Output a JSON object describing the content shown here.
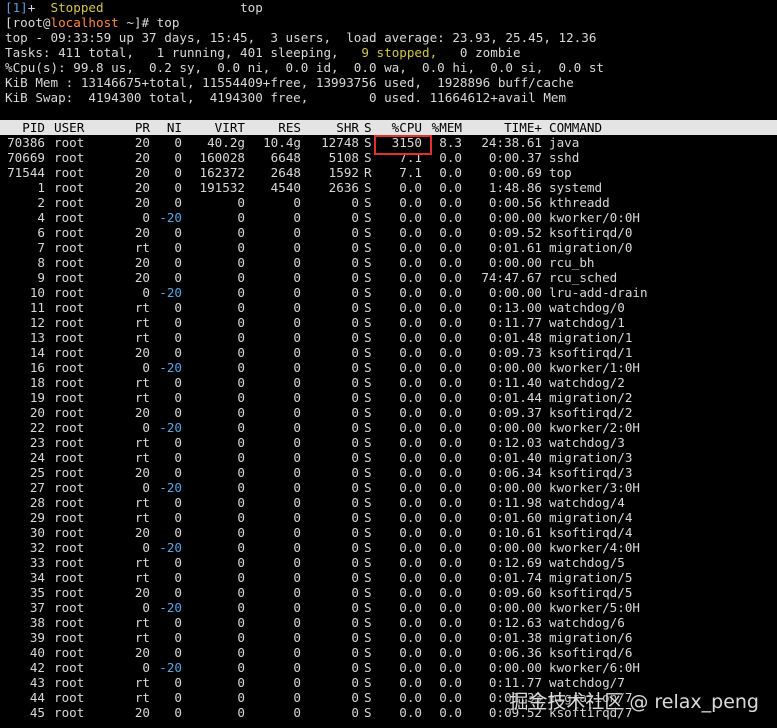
{
  "job_line": {
    "id": "[1]",
    "plus": "+",
    "status": "Stopped",
    "command": "top"
  },
  "prompt_line": {
    "open": "[root@",
    "host": "localhost",
    "rest": " ~]# top"
  },
  "summary": [
    "top - 09:33:59 up 37 days, 15:45,  3 users,  load average: 23.93, 25.45, 12.36",
    "Tasks: 411 total,   1 running, 401 sleeping,   ",
    "%Cpu(s): 99.8 us,  0.2 sy,  0.0 ni,  0.0 id,  0.0 wa,  0.0 hi,  0.0 si,  0.0 st",
    "KiB Mem : 13146675+total, 11554409+free, 13993756 used,  1928896 buff/cache",
    "KiB Swap:  4194300 total,  4194300 free,        0 used. 11664612+avail Mem"
  ],
  "tasks_stopped": "9 stopped,",
  "tasks_zombie": "   0 zombie",
  "columns": {
    "pid": "PID",
    "user": "USER",
    "pr": "PR",
    "ni": "NI",
    "virt": "VIRT",
    "res": "RES",
    "shr": "SHR",
    "s": "S",
    "cpu": "%CPU",
    "mem": "%MEM",
    "time": "TIME+",
    "command": "COMMAND"
  },
  "processes": [
    {
      "pid": "70386",
      "user": "root",
      "pr": "20",
      "ni": "0",
      "virt": "40.2g",
      "res": "10.4g",
      "shr": "12748",
      "s": "S",
      "cpu": "3150",
      "mem": "8.3",
      "time": "24:38.61",
      "command": "java"
    },
    {
      "pid": "70669",
      "user": "root",
      "pr": "20",
      "ni": "0",
      "virt": "160028",
      "res": "6648",
      "shr": "5108",
      "s": "S",
      "cpu": "7.1",
      "mem": "0.0",
      "time": "0:00.37",
      "command": "sshd"
    },
    {
      "pid": "71544",
      "user": "root",
      "pr": "20",
      "ni": "0",
      "virt": "162372",
      "res": "2648",
      "shr": "1592",
      "s": "R",
      "cpu": "7.1",
      "mem": "0.0",
      "time": "0:00.69",
      "command": "top"
    },
    {
      "pid": "1",
      "user": "root",
      "pr": "20",
      "ni": "0",
      "virt": "191532",
      "res": "4540",
      "shr": "2636",
      "s": "S",
      "cpu": "0.0",
      "mem": "0.0",
      "time": "1:48.86",
      "command": "systemd"
    },
    {
      "pid": "2",
      "user": "root",
      "pr": "20",
      "ni": "0",
      "virt": "0",
      "res": "0",
      "shr": "0",
      "s": "S",
      "cpu": "0.0",
      "mem": "0.0",
      "time": "0:00.56",
      "command": "kthreadd"
    },
    {
      "pid": "4",
      "user": "root",
      "pr": "0",
      "ni": "-20",
      "virt": "0",
      "res": "0",
      "shr": "0",
      "s": "S",
      "cpu": "0.0",
      "mem": "0.0",
      "time": "0:00.00",
      "command": "kworker/0:0H"
    },
    {
      "pid": "6",
      "user": "root",
      "pr": "20",
      "ni": "0",
      "virt": "0",
      "res": "0",
      "shr": "0",
      "s": "S",
      "cpu": "0.0",
      "mem": "0.0",
      "time": "0:09.52",
      "command": "ksoftirqd/0"
    },
    {
      "pid": "7",
      "user": "root",
      "pr": "rt",
      "ni": "0",
      "virt": "0",
      "res": "0",
      "shr": "0",
      "s": "S",
      "cpu": "0.0",
      "mem": "0.0",
      "time": "0:01.61",
      "command": "migration/0"
    },
    {
      "pid": "8",
      "user": "root",
      "pr": "20",
      "ni": "0",
      "virt": "0",
      "res": "0",
      "shr": "0",
      "s": "S",
      "cpu": "0.0",
      "mem": "0.0",
      "time": "0:00.00",
      "command": "rcu_bh"
    },
    {
      "pid": "9",
      "user": "root",
      "pr": "20",
      "ni": "0",
      "virt": "0",
      "res": "0",
      "shr": "0",
      "s": "S",
      "cpu": "0.0",
      "mem": "0.0",
      "time": "74:47.67",
      "command": "rcu_sched"
    },
    {
      "pid": "10",
      "user": "root",
      "pr": "0",
      "ni": "-20",
      "virt": "0",
      "res": "0",
      "shr": "0",
      "s": "S",
      "cpu": "0.0",
      "mem": "0.0",
      "time": "0:00.00",
      "command": "lru-add-drain"
    },
    {
      "pid": "11",
      "user": "root",
      "pr": "rt",
      "ni": "0",
      "virt": "0",
      "res": "0",
      "shr": "0",
      "s": "S",
      "cpu": "0.0",
      "mem": "0.0",
      "time": "0:13.00",
      "command": "watchdog/0"
    },
    {
      "pid": "12",
      "user": "root",
      "pr": "rt",
      "ni": "0",
      "virt": "0",
      "res": "0",
      "shr": "0",
      "s": "S",
      "cpu": "0.0",
      "mem": "0.0",
      "time": "0:11.77",
      "command": "watchdog/1"
    },
    {
      "pid": "13",
      "user": "root",
      "pr": "rt",
      "ni": "0",
      "virt": "0",
      "res": "0",
      "shr": "0",
      "s": "S",
      "cpu": "0.0",
      "mem": "0.0",
      "time": "0:01.48",
      "command": "migration/1"
    },
    {
      "pid": "14",
      "user": "root",
      "pr": "20",
      "ni": "0",
      "virt": "0",
      "res": "0",
      "shr": "0",
      "s": "S",
      "cpu": "0.0",
      "mem": "0.0",
      "time": "0:09.73",
      "command": "ksoftirqd/1"
    },
    {
      "pid": "16",
      "user": "root",
      "pr": "0",
      "ni": "-20",
      "virt": "0",
      "res": "0",
      "shr": "0",
      "s": "S",
      "cpu": "0.0",
      "mem": "0.0",
      "time": "0:00.00",
      "command": "kworker/1:0H"
    },
    {
      "pid": "18",
      "user": "root",
      "pr": "rt",
      "ni": "0",
      "virt": "0",
      "res": "0",
      "shr": "0",
      "s": "S",
      "cpu": "0.0",
      "mem": "0.0",
      "time": "0:11.40",
      "command": "watchdog/2"
    },
    {
      "pid": "19",
      "user": "root",
      "pr": "rt",
      "ni": "0",
      "virt": "0",
      "res": "0",
      "shr": "0",
      "s": "S",
      "cpu": "0.0",
      "mem": "0.0",
      "time": "0:01.44",
      "command": "migration/2"
    },
    {
      "pid": "20",
      "user": "root",
      "pr": "20",
      "ni": "0",
      "virt": "0",
      "res": "0",
      "shr": "0",
      "s": "S",
      "cpu": "0.0",
      "mem": "0.0",
      "time": "0:09.37",
      "command": "ksoftirqd/2"
    },
    {
      "pid": "22",
      "user": "root",
      "pr": "0",
      "ni": "-20",
      "virt": "0",
      "res": "0",
      "shr": "0",
      "s": "S",
      "cpu": "0.0",
      "mem": "0.0",
      "time": "0:00.00",
      "command": "kworker/2:0H"
    },
    {
      "pid": "23",
      "user": "root",
      "pr": "rt",
      "ni": "0",
      "virt": "0",
      "res": "0",
      "shr": "0",
      "s": "S",
      "cpu": "0.0",
      "mem": "0.0",
      "time": "0:12.03",
      "command": "watchdog/3"
    },
    {
      "pid": "24",
      "user": "root",
      "pr": "rt",
      "ni": "0",
      "virt": "0",
      "res": "0",
      "shr": "0",
      "s": "S",
      "cpu": "0.0",
      "mem": "0.0",
      "time": "0:01.40",
      "command": "migration/3"
    },
    {
      "pid": "25",
      "user": "root",
      "pr": "20",
      "ni": "0",
      "virt": "0",
      "res": "0",
      "shr": "0",
      "s": "S",
      "cpu": "0.0",
      "mem": "0.0",
      "time": "0:06.34",
      "command": "ksoftirqd/3"
    },
    {
      "pid": "27",
      "user": "root",
      "pr": "0",
      "ni": "-20",
      "virt": "0",
      "res": "0",
      "shr": "0",
      "s": "S",
      "cpu": "0.0",
      "mem": "0.0",
      "time": "0:00.00",
      "command": "kworker/3:0H"
    },
    {
      "pid": "28",
      "user": "root",
      "pr": "rt",
      "ni": "0",
      "virt": "0",
      "res": "0",
      "shr": "0",
      "s": "S",
      "cpu": "0.0",
      "mem": "0.0",
      "time": "0:11.98",
      "command": "watchdog/4"
    },
    {
      "pid": "29",
      "user": "root",
      "pr": "rt",
      "ni": "0",
      "virt": "0",
      "res": "0",
      "shr": "0",
      "s": "S",
      "cpu": "0.0",
      "mem": "0.0",
      "time": "0:01.60",
      "command": "migration/4"
    },
    {
      "pid": "30",
      "user": "root",
      "pr": "20",
      "ni": "0",
      "virt": "0",
      "res": "0",
      "shr": "0",
      "s": "S",
      "cpu": "0.0",
      "mem": "0.0",
      "time": "0:10.61",
      "command": "ksoftirqd/4"
    },
    {
      "pid": "32",
      "user": "root",
      "pr": "0",
      "ni": "-20",
      "virt": "0",
      "res": "0",
      "shr": "0",
      "s": "S",
      "cpu": "0.0",
      "mem": "0.0",
      "time": "0:00.00",
      "command": "kworker/4:0H"
    },
    {
      "pid": "33",
      "user": "root",
      "pr": "rt",
      "ni": "0",
      "virt": "0",
      "res": "0",
      "shr": "0",
      "s": "S",
      "cpu": "0.0",
      "mem": "0.0",
      "time": "0:12.69",
      "command": "watchdog/5"
    },
    {
      "pid": "34",
      "user": "root",
      "pr": "rt",
      "ni": "0",
      "virt": "0",
      "res": "0",
      "shr": "0",
      "s": "S",
      "cpu": "0.0",
      "mem": "0.0",
      "time": "0:01.74",
      "command": "migration/5"
    },
    {
      "pid": "35",
      "user": "root",
      "pr": "20",
      "ni": "0",
      "virt": "0",
      "res": "0",
      "shr": "0",
      "s": "S",
      "cpu": "0.0",
      "mem": "0.0",
      "time": "0:09.60",
      "command": "ksoftirqd/5"
    },
    {
      "pid": "37",
      "user": "root",
      "pr": "0",
      "ni": "-20",
      "virt": "0",
      "res": "0",
      "shr": "0",
      "s": "S",
      "cpu": "0.0",
      "mem": "0.0",
      "time": "0:00.00",
      "command": "kworker/5:0H"
    },
    {
      "pid": "38",
      "user": "root",
      "pr": "rt",
      "ni": "0",
      "virt": "0",
      "res": "0",
      "shr": "0",
      "s": "S",
      "cpu": "0.0",
      "mem": "0.0",
      "time": "0:12.63",
      "command": "watchdog/6"
    },
    {
      "pid": "39",
      "user": "root",
      "pr": "rt",
      "ni": "0",
      "virt": "0",
      "res": "0",
      "shr": "0",
      "s": "S",
      "cpu": "0.0",
      "mem": "0.0",
      "time": "0:01.38",
      "command": "migration/6"
    },
    {
      "pid": "40",
      "user": "root",
      "pr": "20",
      "ni": "0",
      "virt": "0",
      "res": "0",
      "shr": "0",
      "s": "S",
      "cpu": "0.0",
      "mem": "0.0",
      "time": "0:06.36",
      "command": "ksoftirqd/6"
    },
    {
      "pid": "42",
      "user": "root",
      "pr": "0",
      "ni": "-20",
      "virt": "0",
      "res": "0",
      "shr": "0",
      "s": "S",
      "cpu": "0.0",
      "mem": "0.0",
      "time": "0:00.00",
      "command": "kworker/6:0H"
    },
    {
      "pid": "43",
      "user": "root",
      "pr": "rt",
      "ni": "0",
      "virt": "0",
      "res": "0",
      "shr": "0",
      "s": "S",
      "cpu": "0.0",
      "mem": "0.0",
      "time": "0:11.77",
      "command": "watchdog/7"
    },
    {
      "pid": "44",
      "user": "root",
      "pr": "rt",
      "ni": "0",
      "virt": "0",
      "res": "0",
      "shr": "0",
      "s": "S",
      "cpu": "0.0",
      "mem": "0.0",
      "time": "0:01.33",
      "command": "migration/7"
    },
    {
      "pid": "45",
      "user": "root",
      "pr": "20",
      "ni": "0",
      "virt": "0",
      "res": "0",
      "shr": "0",
      "s": "S",
      "cpu": "0.0",
      "mem": "0.0",
      "time": "0:09.52",
      "command": "ksoftirqd/7"
    }
  ],
  "highlight_color": "#e0322a",
  "watermark": "掘金技术社区 @ relax_peng"
}
